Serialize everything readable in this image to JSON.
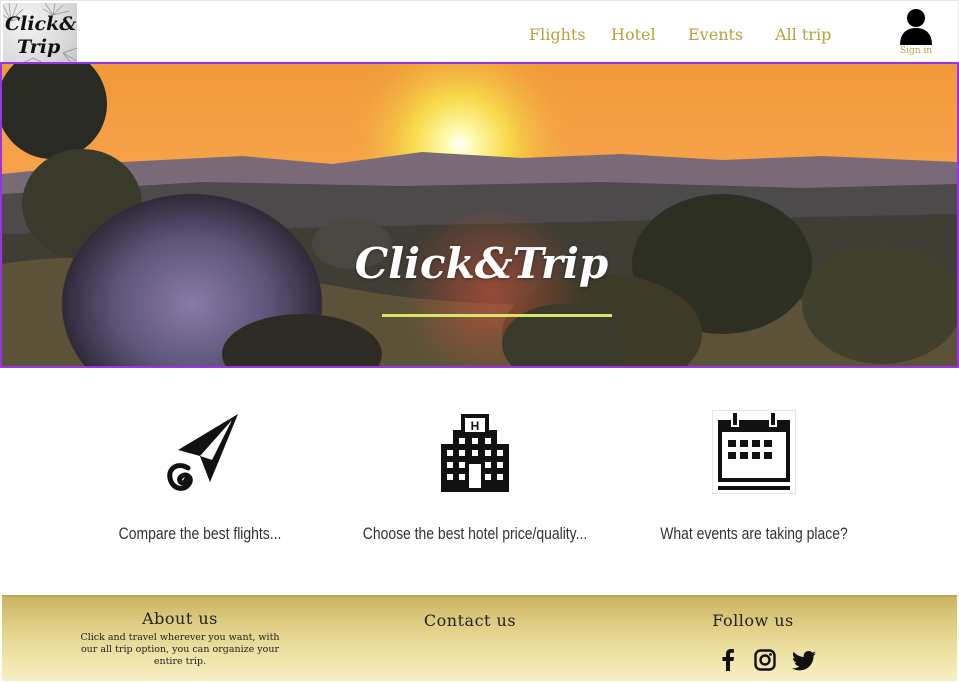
{
  "header": {
    "logo": {
      "line1": "Click&",
      "line2": "Trip"
    },
    "nav": [
      {
        "label": "Flights"
      },
      {
        "label": "Hotel"
      },
      {
        "label": "Events"
      },
      {
        "label": "All trip"
      }
    ],
    "signin_label": "Sign in"
  },
  "hero": {
    "title": "Click&Trip"
  },
  "features": [
    {
      "icon": "paper-plane-icon",
      "label": "Compare the best flights..."
    },
    {
      "icon": "hotel-building-icon",
      "label": "Choose the best hotel price/quality..."
    },
    {
      "icon": "calendar-icon",
      "label": "What events are taking place?"
    }
  ],
  "footer": {
    "about": {
      "heading": "About us",
      "text_line1": "Click and travel wherever you want, with",
      "text_line2": "our all trip option, you can organize your",
      "text_line3": "entire trip."
    },
    "contact": {
      "heading": "Contact us"
    },
    "follow": {
      "heading": "Follow us",
      "icons": [
        "facebook-icon",
        "instagram-icon",
        "twitter-icon"
      ]
    }
  },
  "colors": {
    "accent_gold": "#b9a13d",
    "hero_border": "#9a32e8",
    "hero_underline": "#d9e46a",
    "footer_gold": "#e0cf86"
  }
}
